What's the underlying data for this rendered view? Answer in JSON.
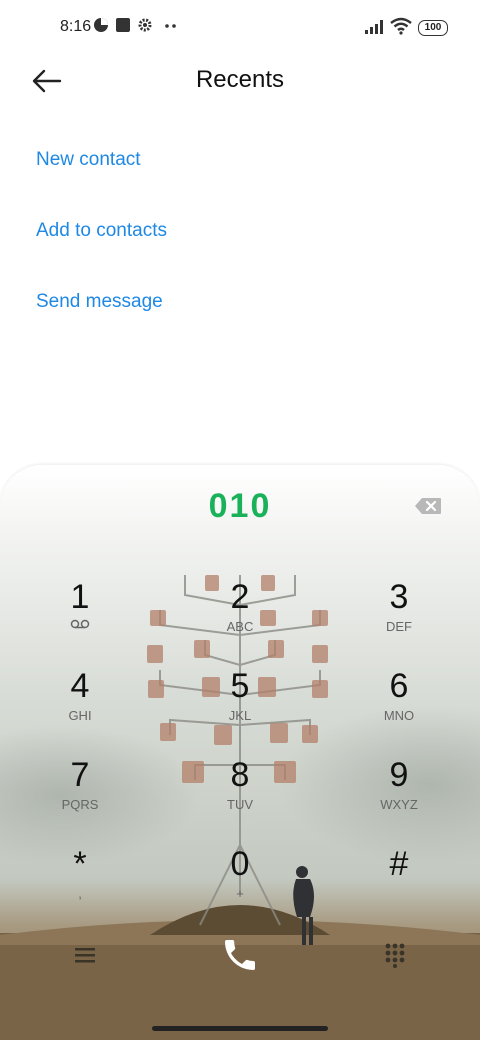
{
  "status_bar": {
    "time": "8:16",
    "battery": "100"
  },
  "header": {
    "title": "Recents"
  },
  "actions": [
    {
      "label": "New contact"
    },
    {
      "label": "Add to contacts"
    },
    {
      "label": "Send message"
    }
  ],
  "dialer": {
    "number": "010",
    "keys": [
      {
        "digit": "1",
        "letters": ""
      },
      {
        "digit": "2",
        "letters": "ABC"
      },
      {
        "digit": "3",
        "letters": "DEF"
      },
      {
        "digit": "4",
        "letters": "GHI"
      },
      {
        "digit": "5",
        "letters": "JKL"
      },
      {
        "digit": "6",
        "letters": "MNO"
      },
      {
        "digit": "7",
        "letters": "PQRS"
      },
      {
        "digit": "8",
        "letters": "TUV"
      },
      {
        "digit": "9",
        "letters": "WXYZ"
      },
      {
        "digit": "*",
        "letters": ","
      },
      {
        "digit": "0",
        "letters": "+"
      },
      {
        "digit": "#",
        "letters": ""
      }
    ]
  },
  "colors": {
    "accent": "#1e88e5",
    "number": "#19b25a"
  }
}
